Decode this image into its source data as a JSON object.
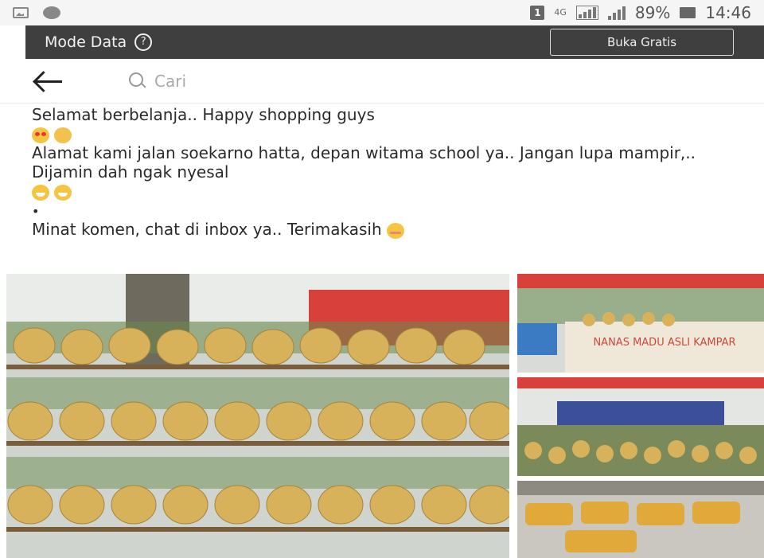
{
  "status_bar": {
    "sim_slot": "1",
    "network": "4G",
    "battery": "89%",
    "time": "14:46",
    "icons": [
      "image-icon",
      "gear-icon",
      "sim-icon",
      "signal-icon",
      "battery-icon"
    ]
  },
  "data_mode": {
    "title": "Mode Data",
    "help": "?",
    "open_free_label": "Buka Gratis"
  },
  "search": {
    "placeholder": "Cari"
  },
  "post": {
    "line1": "Selamat berbelanja.. Happy shopping guys",
    "line2": "Alamat kami jalan soekarno hatta, depan witama school ya.. Jangan lupa mampir,.. Dijamin dah ngak nyesal",
    "bullet": "•",
    "line3": "Minat komen, chat di inbox ya.. Terimakasih",
    "emoji1": [
      "heart-eyes-emoji",
      "hugging-emoji"
    ],
    "emoji2": [
      "grin-emoji",
      "grin-emoji"
    ],
    "emoji3": [
      "blush-emoji"
    ]
  },
  "photos": {
    "main_alt": "pineapples stacked on wooden rack",
    "stall_sign": "NANAS MADU ASLI KAMPAR",
    "colors": {
      "pineapple": "#d8b25a",
      "leaves": "#6c8b4f",
      "tarp": "#d8403c",
      "crate": "#3b7bc4"
    }
  }
}
